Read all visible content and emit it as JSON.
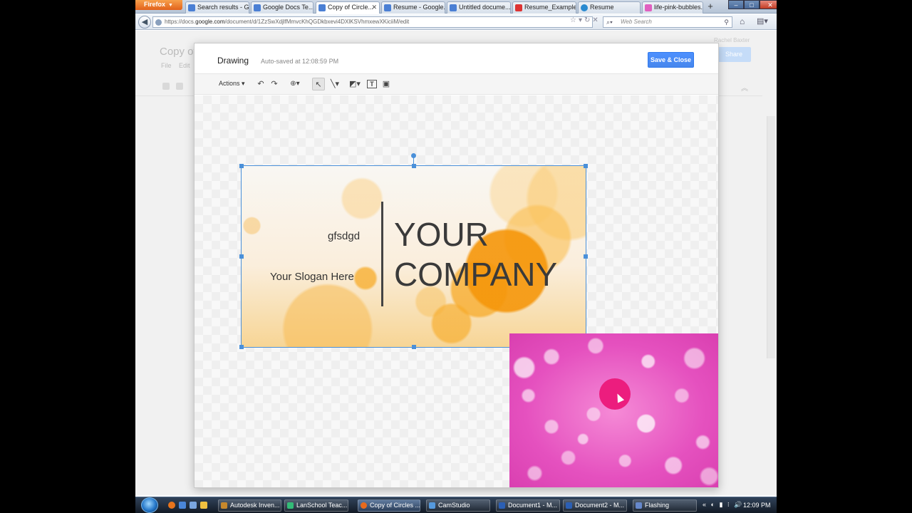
{
  "browser": {
    "app_button": "Firefox",
    "tabs": [
      {
        "label": "Search results - G...",
        "icon": "search-results-icon",
        "color": "#4a7fd4"
      },
      {
        "label": "Google Docs Te...",
        "icon": "google-docs-icon",
        "color": "#4a7fd4"
      },
      {
        "label": "Copy of Circle...",
        "icon": "google-docs-icon",
        "color": "#4a7fd4",
        "active": true
      },
      {
        "label": "Resume - Google...",
        "icon": "google-docs-icon",
        "color": "#4a7fd4"
      },
      {
        "label": "Untitled docume...",
        "icon": "google-docs-icon",
        "color": "#4a7fd4"
      },
      {
        "label": "Resume_Example...",
        "icon": "pdf-icon",
        "color": "#d33"
      },
      {
        "label": "Resume",
        "icon": "globe-icon",
        "color": "#2a8ad0"
      },
      {
        "label": "life-pink-bubbles...",
        "icon": "image-icon",
        "color": "#e060c0"
      }
    ],
    "new_tab_symbol": "+",
    "window_controls": {
      "minimize": "–",
      "maximize": "□",
      "close": "✕"
    },
    "url_prefix": "https://docs.",
    "url_domain": "google.com",
    "url_path": "/document/d/1ZzSwXdjlfMmvcKhQGDkbxevi4DXlKSVhmxewXKiciiM/edit",
    "search_placeholder": "Web Search"
  },
  "doc": {
    "title": "Copy of",
    "menu": "File   Edit",
    "user": "Rachel Baxter",
    "share_label": "Share"
  },
  "drawing": {
    "title": "Drawing",
    "autosave": "Auto-saved at 12:08:59 PM",
    "save_close": "Save & Close",
    "actions_label": "Actions",
    "tools": [
      {
        "name": "undo-icon",
        "glyph": "↶"
      },
      {
        "name": "redo-icon",
        "glyph": "↷"
      },
      {
        "name": "zoom-icon",
        "glyph": "🔍"
      },
      {
        "name": "select-arrow-icon",
        "glyph": "↖"
      },
      {
        "name": "line-icon",
        "glyph": "╲"
      },
      {
        "name": "shape-icon",
        "glyph": "◩"
      },
      {
        "name": "textbox-icon",
        "glyph": "T"
      },
      {
        "name": "image-icon",
        "glyph": "▣"
      }
    ],
    "card": {
      "name_text": "gfsdgd",
      "slogan": "Your Slogan Here",
      "company": "YOUR\nCOMPANY"
    }
  },
  "taskbar": {
    "tasks": [
      {
        "label": "Autodesk Inven...",
        "color": "#c7882c"
      },
      {
        "label": "LanSchool Teac...",
        "color": "#3b7"
      },
      {
        "label": "Copy of Circles ...",
        "color": "#e86a1c",
        "active": true
      },
      {
        "label": "CamStudio",
        "color": "#5599dd"
      },
      {
        "label": "Document1 - M...",
        "color": "#2b5fb4"
      },
      {
        "label": "Document2 - M...",
        "color": "#2b5fb4"
      },
      {
        "label": "Flashing",
        "color": "#6688cc"
      }
    ],
    "tray": "« ◐ ▮ ⁝ 🔊",
    "clock": "12:09 PM"
  },
  "colors": {
    "accent": "#4d90fe",
    "selection": "#4a90d9",
    "highlight_dot": "#ec1d7e"
  }
}
